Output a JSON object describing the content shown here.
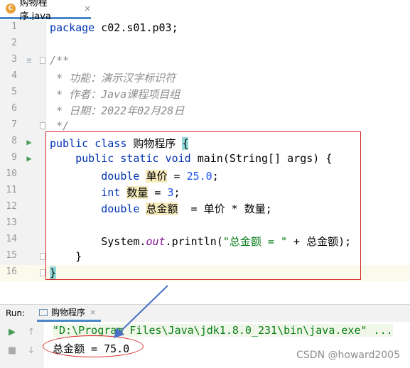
{
  "tab": {
    "icon": "java-class-icon",
    "label": "购物程序.java",
    "close": "×"
  },
  "editor": {
    "lines": [
      {
        "num": "1",
        "tokens": [
          {
            "t": "package ",
            "c": "kw"
          },
          {
            "t": "c02.s01.p03;",
            "c": ""
          }
        ]
      },
      {
        "num": "2",
        "tokens": []
      },
      {
        "num": "3",
        "tokens": [
          {
            "t": "/**",
            "c": "cmt"
          }
        ]
      },
      {
        "num": "4",
        "tokens": [
          {
            "t": " * 功能：演示汉字标识符",
            "c": "cmt"
          }
        ]
      },
      {
        "num": "5",
        "tokens": [
          {
            "t": " * 作者：Java课程项目组",
            "c": "cmt"
          }
        ]
      },
      {
        "num": "6",
        "tokens": [
          {
            "t": " * 日期：2022年02月28日",
            "c": "cmt"
          }
        ]
      },
      {
        "num": "7",
        "tokens": [
          {
            "t": " */",
            "c": "cmt"
          }
        ]
      },
      {
        "num": "8",
        "tokens": [
          {
            "t": "public class ",
            "c": "kw"
          },
          {
            "t": "购物程序",
            "c": ""
          },
          {
            "t": " ",
            "c": ""
          },
          {
            "t": "{",
            "c": "brace-hl"
          }
        ]
      },
      {
        "num": "9",
        "tokens": [
          {
            "t": "    public static void ",
            "c": "kw"
          },
          {
            "t": "main(String[] args) {",
            "c": ""
          }
        ]
      },
      {
        "num": "10",
        "tokens": [
          {
            "t": "        double ",
            "c": "kw"
          },
          {
            "t": "单价",
            "c": "hl"
          },
          {
            "t": " = ",
            "c": ""
          },
          {
            "t": "25.0",
            "c": "num"
          },
          {
            "t": ";",
            "c": ""
          }
        ]
      },
      {
        "num": "11",
        "tokens": [
          {
            "t": "        int ",
            "c": "kw"
          },
          {
            "t": "数量",
            "c": "hl"
          },
          {
            "t": " = ",
            "c": ""
          },
          {
            "t": "3",
            "c": "num"
          },
          {
            "t": ";",
            "c": ""
          }
        ]
      },
      {
        "num": "12",
        "tokens": [
          {
            "t": "        double ",
            "c": "kw"
          },
          {
            "t": "总金额",
            "c": "hl"
          },
          {
            "t": "  = 单价 * 数量;",
            "c": ""
          }
        ]
      },
      {
        "num": "13",
        "tokens": []
      },
      {
        "num": "14",
        "tokens": [
          {
            "t": "        System.",
            "c": ""
          },
          {
            "t": "out",
            "c": "fld"
          },
          {
            "t": ".println(",
            "c": ""
          },
          {
            "t": "\"总金额 = \"",
            "c": "str"
          },
          {
            "t": " + 总金额);",
            "c": ""
          }
        ]
      },
      {
        "num": "15",
        "tokens": [
          {
            "t": "    }",
            "c": ""
          }
        ]
      },
      {
        "num": "16",
        "tokens": [
          {
            "t": "}",
            "c": "brace-hl"
          }
        ]
      }
    ]
  },
  "run": {
    "label": "Run:",
    "tab_label": "购物程序",
    "tab_close": "×",
    "command": "\"D:\\Program Files\\Java\\jdk1.8.0_231\\bin\\java.exe\" ...",
    "output": "总金额 = 75.0"
  },
  "watermark": "CSDN @howard2005",
  "colors": {
    "accent": "#4a88c7",
    "annotation": "#d52b2b",
    "run_green": "#499c54"
  }
}
